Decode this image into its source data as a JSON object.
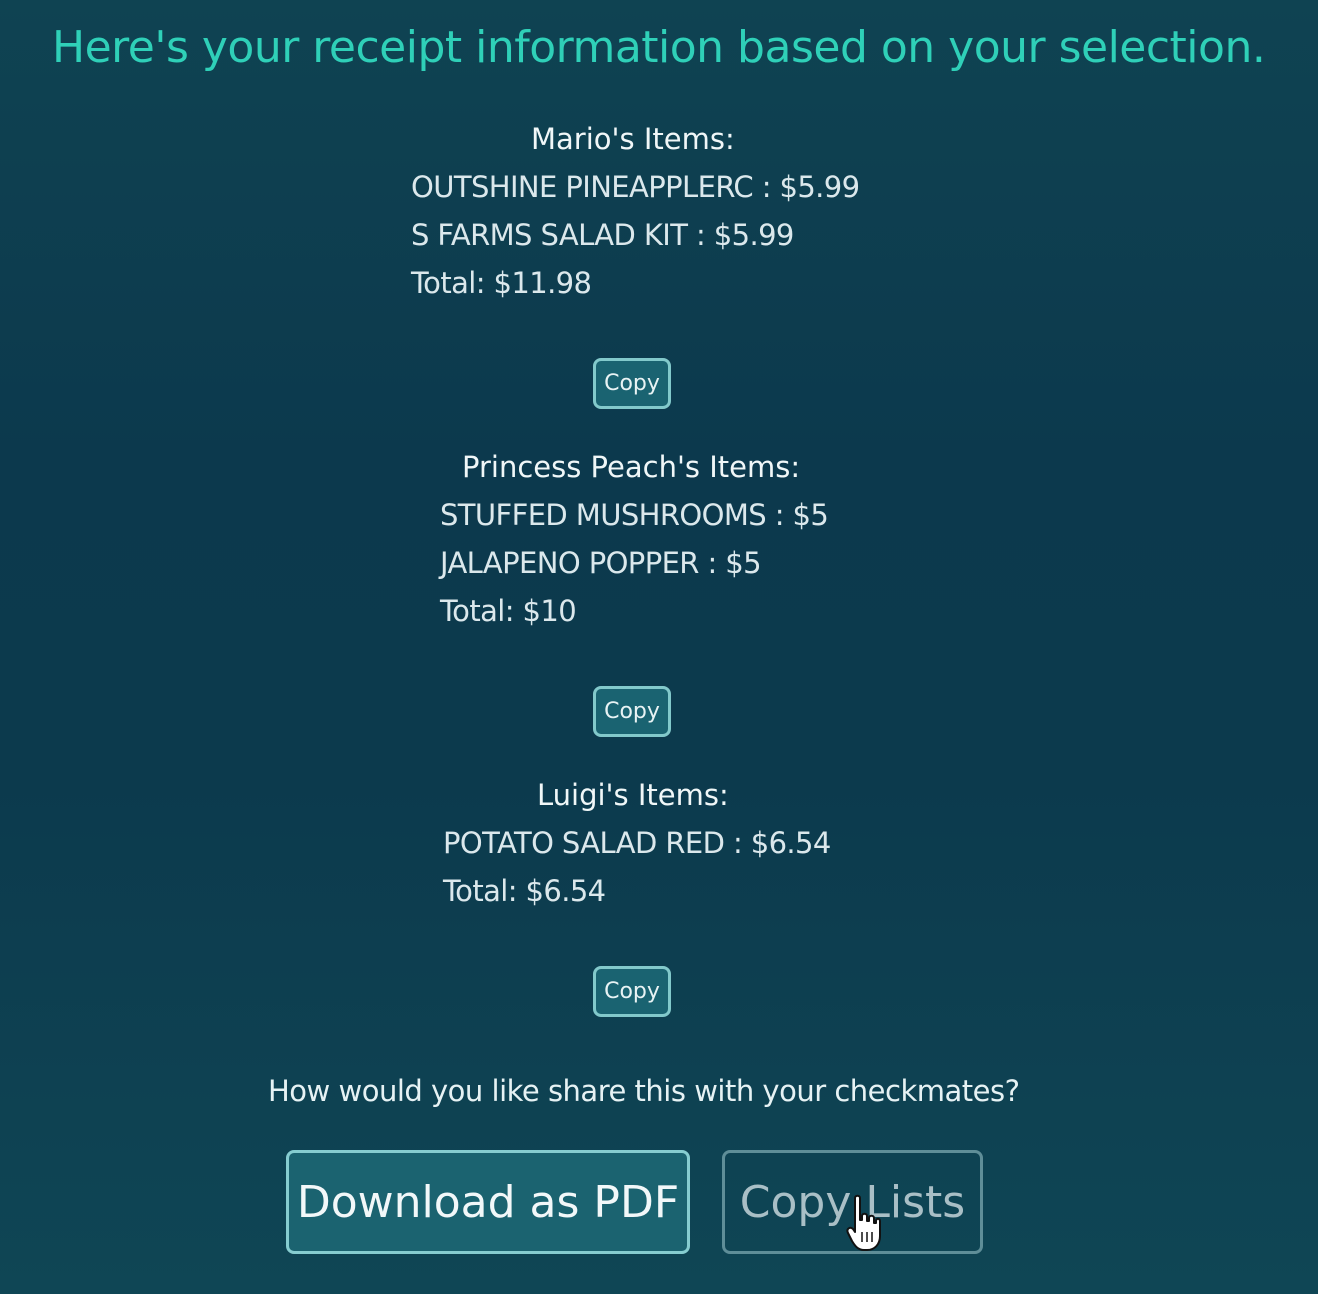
{
  "headline": "Here's your receipt information based on your selection.",
  "people": [
    {
      "title": "Mario's Items:",
      "items": [
        "OUTSHINE PINEAPPLERC : $5.99",
        "S FARMS SALAD KIT : $5.99"
      ],
      "total": "Total: $11.98",
      "copy_label": "Copy"
    },
    {
      "title": "Princess Peach's Items:",
      "items": [
        "STUFFED MUSHROOMS : $5",
        "JALAPENO POPPER : $5"
      ],
      "total": "Total: $10",
      "copy_label": "Copy"
    },
    {
      "title": "Luigi's Items:",
      "items": [
        "POTATO SALAD RED : $6.54"
      ],
      "total": "Total: $6.54",
      "copy_label": "Copy"
    }
  ],
  "share": {
    "question": "How would you like share this with your checkmates?",
    "download_label": "Download as PDF",
    "copy_lists_label": "Copy Lists"
  },
  "colors": {
    "accent": "#2fd0b8",
    "background": "#0c394d",
    "button": "#1b6370"
  }
}
